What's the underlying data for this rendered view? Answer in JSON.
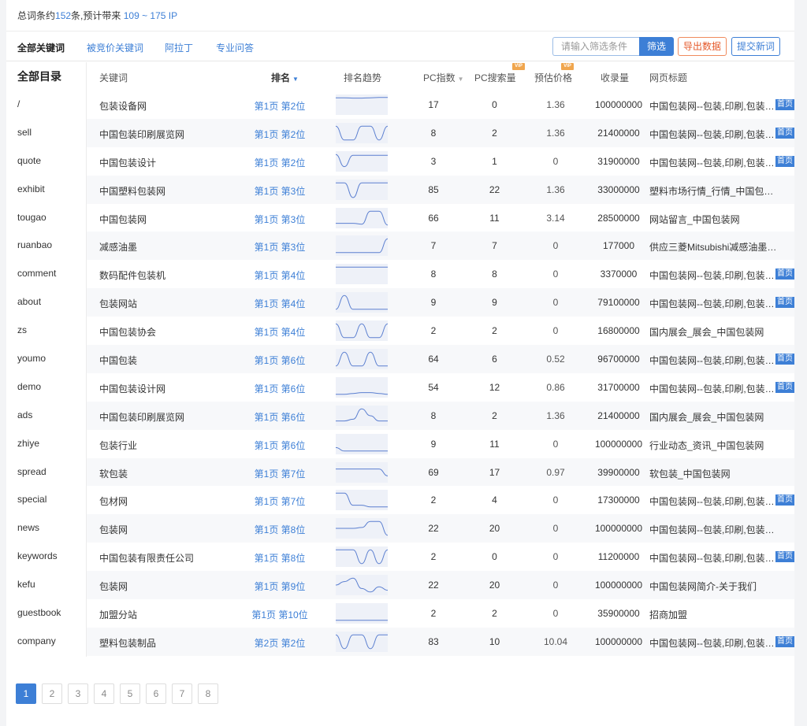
{
  "summary": {
    "prefix": "总词条约",
    "count": "152",
    "mid": "条,预计带来 ",
    "ip_range": "109 ~ 175 IP"
  },
  "tabs": [
    {
      "label": "全部关键词",
      "active": true
    },
    {
      "label": "被竞价关键词",
      "active": false
    },
    {
      "label": "阿拉丁",
      "active": false
    },
    {
      "label": "专业问答",
      "active": false
    }
  ],
  "toolbar": {
    "filter_placeholder": "请输入筛选条件",
    "filter_label": "筛选",
    "export_label": "导出数据",
    "submit_label": "提交新词"
  },
  "sidebar": {
    "title": "全部目录",
    "items": [
      "/",
      "sell",
      "quote",
      "exhibit",
      "tougao",
      "ruanbao",
      "comment",
      "about",
      "zs",
      "youmo",
      "demo",
      "ads",
      "zhiye",
      "spread",
      "special",
      "news",
      "keywords",
      "kefu",
      "guestbook",
      "company"
    ]
  },
  "table": {
    "headers": {
      "keyword": "关键词",
      "rank": "排名",
      "trend": "排名趋势",
      "pc_index": "PC指数",
      "pc_search": "PC搜索量",
      "price": "预估价格",
      "indexed": "收录量",
      "page_title": "网页标题"
    },
    "vip_label": "VIP",
    "home_badge": "首页",
    "rows": [
      {
        "keyword": "包装设备网",
        "rank": "第1页 第2位",
        "pc_index": "17",
        "pc_search": "0",
        "price": "1.36",
        "indexed": "100000000",
        "title": "中国包装网--包装,印刷,包装机械",
        "home": true,
        "trend": [
          0.9,
          0.9,
          0.88,
          0.88,
          0.9,
          0.92,
          0.92
        ]
      },
      {
        "keyword": "中国包装印刷展览网",
        "rank": "第1页 第2位",
        "pc_index": "8",
        "pc_search": "2",
        "price": "1.36",
        "indexed": "21400000",
        "title": "中国包装网--包装,印刷,包装机械",
        "home": true,
        "trend": [
          0.9,
          0.1,
          0.1,
          0.9,
          0.9,
          0.1,
          0.9
        ]
      },
      {
        "keyword": "中国包装设计",
        "rank": "第1页 第2位",
        "pc_index": "3",
        "pc_search": "1",
        "price": "0",
        "indexed": "31900000",
        "title": "中国包装网--包装,印刷,包装机械",
        "home": true,
        "trend": [
          0.9,
          0.2,
          0.85,
          0.85,
          0.85,
          0.85,
          0.85
        ]
      },
      {
        "keyword": "中国塑料包装网",
        "rank": "第1页 第3位",
        "pc_index": "85",
        "pc_search": "22",
        "price": "1.36",
        "indexed": "33000000",
        "title": "塑料市场行情_行情_中国包装网",
        "home": false,
        "trend": [
          0.9,
          0.9,
          0.05,
          0.9,
          0.9,
          0.9,
          0.9
        ]
      },
      {
        "keyword": "中国包装网",
        "rank": "第1页 第3位",
        "pc_index": "66",
        "pc_search": "11",
        "price": "3.14",
        "indexed": "28500000",
        "title": "网站留言_中国包装网",
        "home": false,
        "trend": [
          0.2,
          0.2,
          0.2,
          0.15,
          0.9,
          0.9,
          0.1
        ]
      },
      {
        "keyword": "减感油墨",
        "rank": "第1页 第3位",
        "pc_index": "7",
        "pc_search": "7",
        "price": "0",
        "indexed": "177000",
        "title": "供应三菱Mitsubishi减感油墨_中国包装网",
        "home": false,
        "trend": [
          0.1,
          0.1,
          0.1,
          0.1,
          0.1,
          0.1,
          0.9
        ]
      },
      {
        "keyword": "数码配件包装机",
        "rank": "第1页 第4位",
        "pc_index": "8",
        "pc_search": "8",
        "price": "0",
        "indexed": "3370000",
        "title": "中国包装网--包装,印刷,包装机械",
        "home": true,
        "trend": [
          0.9,
          0.9,
          0.9,
          0.9,
          0.9,
          0.9,
          0.9
        ]
      },
      {
        "keyword": "包装网站",
        "rank": "第1页 第4位",
        "pc_index": "9",
        "pc_search": "9",
        "price": "0",
        "indexed": "79100000",
        "title": "中国包装网--包装,印刷,包装机械",
        "home": true,
        "trend": [
          0.1,
          0.9,
          0.1,
          0.1,
          0.1,
          0.1,
          0.1
        ]
      },
      {
        "keyword": "中国包装协会",
        "rank": "第1页 第4位",
        "pc_index": "2",
        "pc_search": "2",
        "price": "0",
        "indexed": "16800000",
        "title": "国内展会_展会_中国包装网",
        "home": false,
        "trend": [
          0.9,
          0.1,
          0.1,
          0.9,
          0.1,
          0.1,
          0.9
        ]
      },
      {
        "keyword": "中国包装",
        "rank": "第1页 第6位",
        "pc_index": "64",
        "pc_search": "6",
        "price": "0.52",
        "indexed": "96700000",
        "title": "中国包装网--包装,印刷,包装机械",
        "home": true,
        "trend": [
          0.1,
          0.9,
          0.1,
          0.1,
          0.9,
          0.1,
          0.1
        ]
      },
      {
        "keyword": "中国包装设计网",
        "rank": "第1页 第6位",
        "pc_index": "54",
        "pc_search": "12",
        "price": "0.86",
        "indexed": "31700000",
        "title": "中国包装网--包装,印刷,包装机械",
        "home": true,
        "trend": [
          0.1,
          0.1,
          0.15,
          0.2,
          0.2,
          0.15,
          0.1
        ]
      },
      {
        "keyword": "中国包装印刷展览网",
        "rank": "第1页 第6位",
        "pc_index": "8",
        "pc_search": "2",
        "price": "1.36",
        "indexed": "21400000",
        "title": "国内展会_展会_中国包装网",
        "home": false,
        "trend": [
          0.2,
          0.2,
          0.3,
          0.9,
          0.5,
          0.2,
          0.2
        ]
      },
      {
        "keyword": "包装行业",
        "rank": "第1页 第6位",
        "pc_index": "9",
        "pc_search": "11",
        "price": "0",
        "indexed": "100000000",
        "title": "行业动态_资讯_中国包装网",
        "home": false,
        "trend": [
          0.3,
          0.1,
          0.1,
          0.1,
          0.1,
          0.1,
          0.1
        ]
      },
      {
        "keyword": "软包装",
        "rank": "第1页 第7位",
        "pc_index": "69",
        "pc_search": "17",
        "price": "0.97",
        "indexed": "39900000",
        "title": "软包装_中国包装网",
        "home": false,
        "trend": [
          0.7,
          0.7,
          0.7,
          0.7,
          0.7,
          0.7,
          0.3
        ]
      },
      {
        "keyword": "包材网",
        "rank": "第1页 第7位",
        "pc_index": "2",
        "pc_search": "4",
        "price": "0",
        "indexed": "17300000",
        "title": "中国包装网--包装,印刷,包装机械",
        "home": true,
        "trend": [
          0.9,
          0.9,
          0.2,
          0.2,
          0.1,
          0.1,
          0.1
        ]
      },
      {
        "keyword": "包装网",
        "rank": "第1页 第8位",
        "pc_index": "22",
        "pc_search": "20",
        "price": "0",
        "indexed": "100000000",
        "title": "中国包装网--包装,印刷,包装机械...",
        "home": false,
        "trend": [
          0.5,
          0.5,
          0.5,
          0.55,
          0.9,
          0.9,
          0.1
        ]
      },
      {
        "keyword": "中国包装有限责任公司",
        "rank": "第1页 第8位",
        "pc_index": "2",
        "pc_search": "0",
        "price": "0",
        "indexed": "11200000",
        "title": "中国包装网--包装,印刷,包装机械",
        "home": true,
        "trend": [
          0.9,
          0.9,
          0.9,
          0.1,
          0.9,
          0.1,
          0.9
        ]
      },
      {
        "keyword": "包装网",
        "rank": "第1页 第9位",
        "pc_index": "22",
        "pc_search": "20",
        "price": "0",
        "indexed": "100000000",
        "title": "中国包装网简介-关于我们",
        "home": false,
        "trend": [
          0.5,
          0.7,
          0.9,
          0.3,
          0.1,
          0.4,
          0.2
        ]
      },
      {
        "keyword": "加盟分站",
        "rank": "第1页 第10位",
        "pc_index": "2",
        "pc_search": "2",
        "price": "0",
        "indexed": "35900000",
        "title": "招商加盟",
        "home": false,
        "trend": [
          0.1,
          0.1,
          0.1,
          0.1,
          0.1,
          0.1,
          0.1
        ]
      },
      {
        "keyword": "塑料包装制品",
        "rank": "第2页 第2位",
        "pc_index": "83",
        "pc_search": "10",
        "price": "10.04",
        "indexed": "100000000",
        "title": "中国包装网--包装,印刷,包装机械",
        "home": true,
        "trend": [
          0.9,
          0.1,
          0.9,
          0.9,
          0.1,
          0.9,
          0.9
        ]
      }
    ]
  },
  "pagination": {
    "pages": [
      "1",
      "2",
      "3",
      "4",
      "5",
      "6",
      "7",
      "8"
    ],
    "current": "1"
  }
}
